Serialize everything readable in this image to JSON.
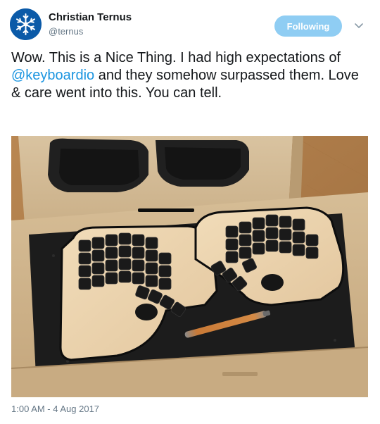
{
  "author": {
    "name": "Christian Ternus",
    "handle": "@ternus",
    "avatar": "snowflake-avatar"
  },
  "follow_button": {
    "label": "Following",
    "color": "#8fcdf3"
  },
  "menu": {
    "icon": "chevron-down-icon"
  },
  "tweet": {
    "text_before_mention": "Wow. This is a Nice Thing. I had high expectations of ",
    "mention": "@keyboardio",
    "text_after_mention": " and they somehow surpassed them. Love & care went into this. You can tell.",
    "mention_color": "#1b95e0"
  },
  "photo": {
    "subject": "keyboard-in-box-photo"
  },
  "timestamp": "1:00 AM - 4 Aug 2017"
}
